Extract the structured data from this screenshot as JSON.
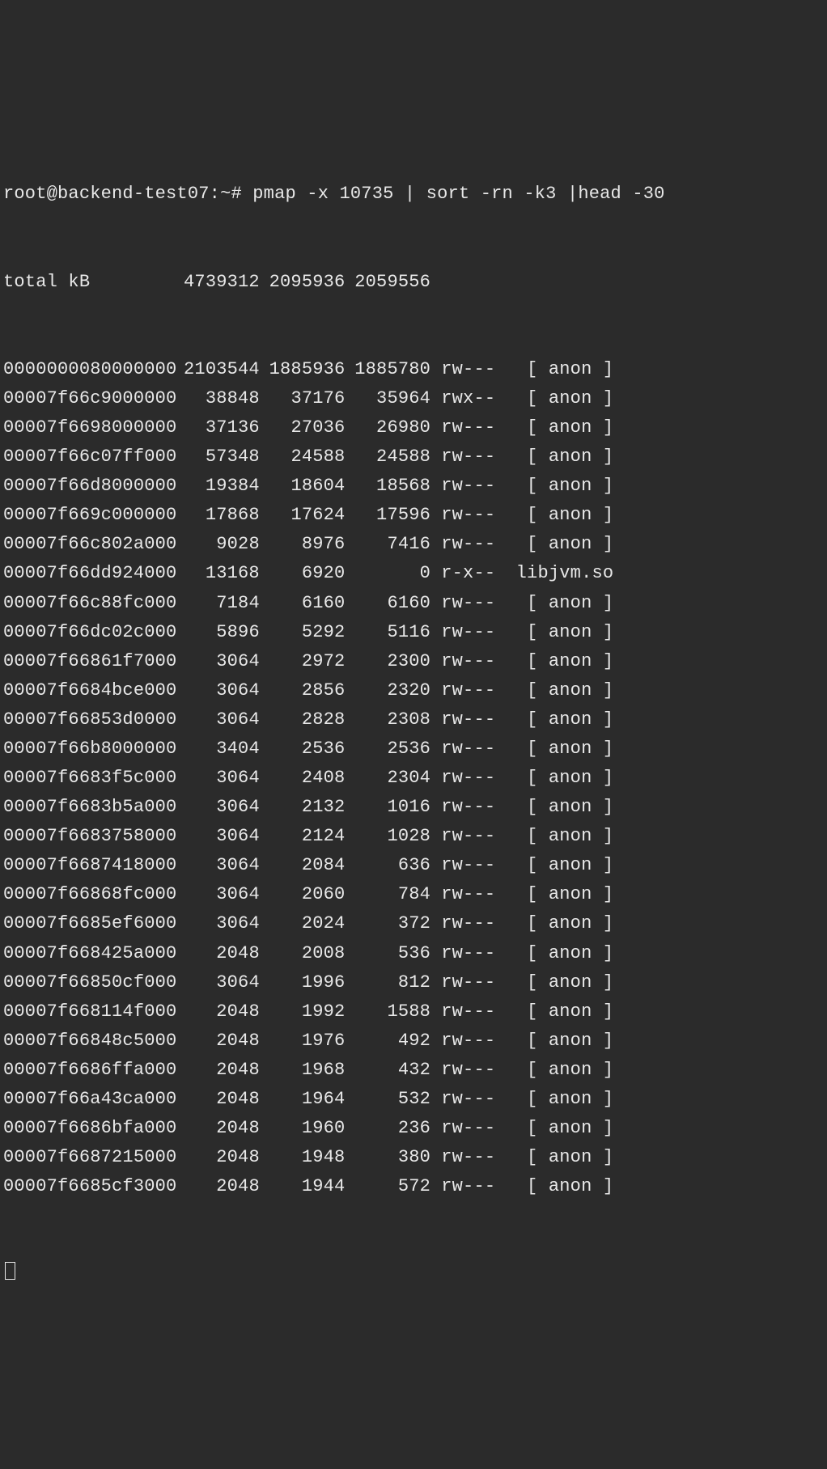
{
  "prompt": {
    "user_host": "root@backend-test07",
    "path": "~",
    "symbol": "#",
    "command": "pmap -x 10735 | sort -rn -k3 |head -30"
  },
  "total": {
    "label": "total kB",
    "kbytes": "4739312",
    "rss": "2095936",
    "dirty": "2059556"
  },
  "rows": [
    {
      "addr": "0000000080000000",
      "kb": "2103544",
      "rss": "1885936",
      "dirty": "1885780",
      "mode": "rw---",
      "map": "[ anon ]"
    },
    {
      "addr": "00007f66c9000000",
      "kb": "38848",
      "rss": "37176",
      "dirty": "35964",
      "mode": "rwx--",
      "map": "[ anon ]"
    },
    {
      "addr": "00007f6698000000",
      "kb": "37136",
      "rss": "27036",
      "dirty": "26980",
      "mode": "rw---",
      "map": "[ anon ]"
    },
    {
      "addr": "00007f66c07ff000",
      "kb": "57348",
      "rss": "24588",
      "dirty": "24588",
      "mode": "rw---",
      "map": "[ anon ]"
    },
    {
      "addr": "00007f66d8000000",
      "kb": "19384",
      "rss": "18604",
      "dirty": "18568",
      "mode": "rw---",
      "map": "[ anon ]"
    },
    {
      "addr": "00007f669c000000",
      "kb": "17868",
      "rss": "17624",
      "dirty": "17596",
      "mode": "rw---",
      "map": "[ anon ]"
    },
    {
      "addr": "00007f66c802a000",
      "kb": "9028",
      "rss": "8976",
      "dirty": "7416",
      "mode": "rw---",
      "map": "[ anon ]"
    },
    {
      "addr": "00007f66dd924000",
      "kb": "13168",
      "rss": "6920",
      "dirty": "0",
      "mode": "r-x--",
      "map": "libjvm.so"
    },
    {
      "addr": "00007f66c88fc000",
      "kb": "7184",
      "rss": "6160",
      "dirty": "6160",
      "mode": "rw---",
      "map": "[ anon ]"
    },
    {
      "addr": "00007f66dc02c000",
      "kb": "5896",
      "rss": "5292",
      "dirty": "5116",
      "mode": "rw---",
      "map": "[ anon ]"
    },
    {
      "addr": "00007f66861f7000",
      "kb": "3064",
      "rss": "2972",
      "dirty": "2300",
      "mode": "rw---",
      "map": "[ anon ]"
    },
    {
      "addr": "00007f6684bce000",
      "kb": "3064",
      "rss": "2856",
      "dirty": "2320",
      "mode": "rw---",
      "map": "[ anon ]"
    },
    {
      "addr": "00007f66853d0000",
      "kb": "3064",
      "rss": "2828",
      "dirty": "2308",
      "mode": "rw---",
      "map": "[ anon ]"
    },
    {
      "addr": "00007f66b8000000",
      "kb": "3404",
      "rss": "2536",
      "dirty": "2536",
      "mode": "rw---",
      "map": "[ anon ]"
    },
    {
      "addr": "00007f6683f5c000",
      "kb": "3064",
      "rss": "2408",
      "dirty": "2304",
      "mode": "rw---",
      "map": "[ anon ]"
    },
    {
      "addr": "00007f6683b5a000",
      "kb": "3064",
      "rss": "2132",
      "dirty": "1016",
      "mode": "rw---",
      "map": "[ anon ]"
    },
    {
      "addr": "00007f6683758000",
      "kb": "3064",
      "rss": "2124",
      "dirty": "1028",
      "mode": "rw---",
      "map": "[ anon ]"
    },
    {
      "addr": "00007f6687418000",
      "kb": "3064",
      "rss": "2084",
      "dirty": "636",
      "mode": "rw---",
      "map": "[ anon ]"
    },
    {
      "addr": "00007f66868fc000",
      "kb": "3064",
      "rss": "2060",
      "dirty": "784",
      "mode": "rw---",
      "map": "[ anon ]"
    },
    {
      "addr": "00007f6685ef6000",
      "kb": "3064",
      "rss": "2024",
      "dirty": "372",
      "mode": "rw---",
      "map": "[ anon ]"
    },
    {
      "addr": "00007f668425a000",
      "kb": "2048",
      "rss": "2008",
      "dirty": "536",
      "mode": "rw---",
      "map": "[ anon ]"
    },
    {
      "addr": "00007f66850cf000",
      "kb": "3064",
      "rss": "1996",
      "dirty": "812",
      "mode": "rw---",
      "map": "[ anon ]"
    },
    {
      "addr": "00007f668114f000",
      "kb": "2048",
      "rss": "1992",
      "dirty": "1588",
      "mode": "rw---",
      "map": "[ anon ]"
    },
    {
      "addr": "00007f66848c5000",
      "kb": "2048",
      "rss": "1976",
      "dirty": "492",
      "mode": "rw---",
      "map": "[ anon ]"
    },
    {
      "addr": "00007f6686ffa000",
      "kb": "2048",
      "rss": "1968",
      "dirty": "432",
      "mode": "rw---",
      "map": "[ anon ]"
    },
    {
      "addr": "00007f66a43ca000",
      "kb": "2048",
      "rss": "1964",
      "dirty": "532",
      "mode": "rw---",
      "map": "[ anon ]"
    },
    {
      "addr": "00007f6686bfa000",
      "kb": "2048",
      "rss": "1960",
      "dirty": "236",
      "mode": "rw---",
      "map": "[ anon ]"
    },
    {
      "addr": "00007f6687215000",
      "kb": "2048",
      "rss": "1948",
      "dirty": "380",
      "mode": "rw---",
      "map": "[ anon ]"
    },
    {
      "addr": "00007f6685cf3000",
      "kb": "2048",
      "rss": "1944",
      "dirty": "572",
      "mode": "rw---",
      "map": "[ anon ]"
    }
  ]
}
